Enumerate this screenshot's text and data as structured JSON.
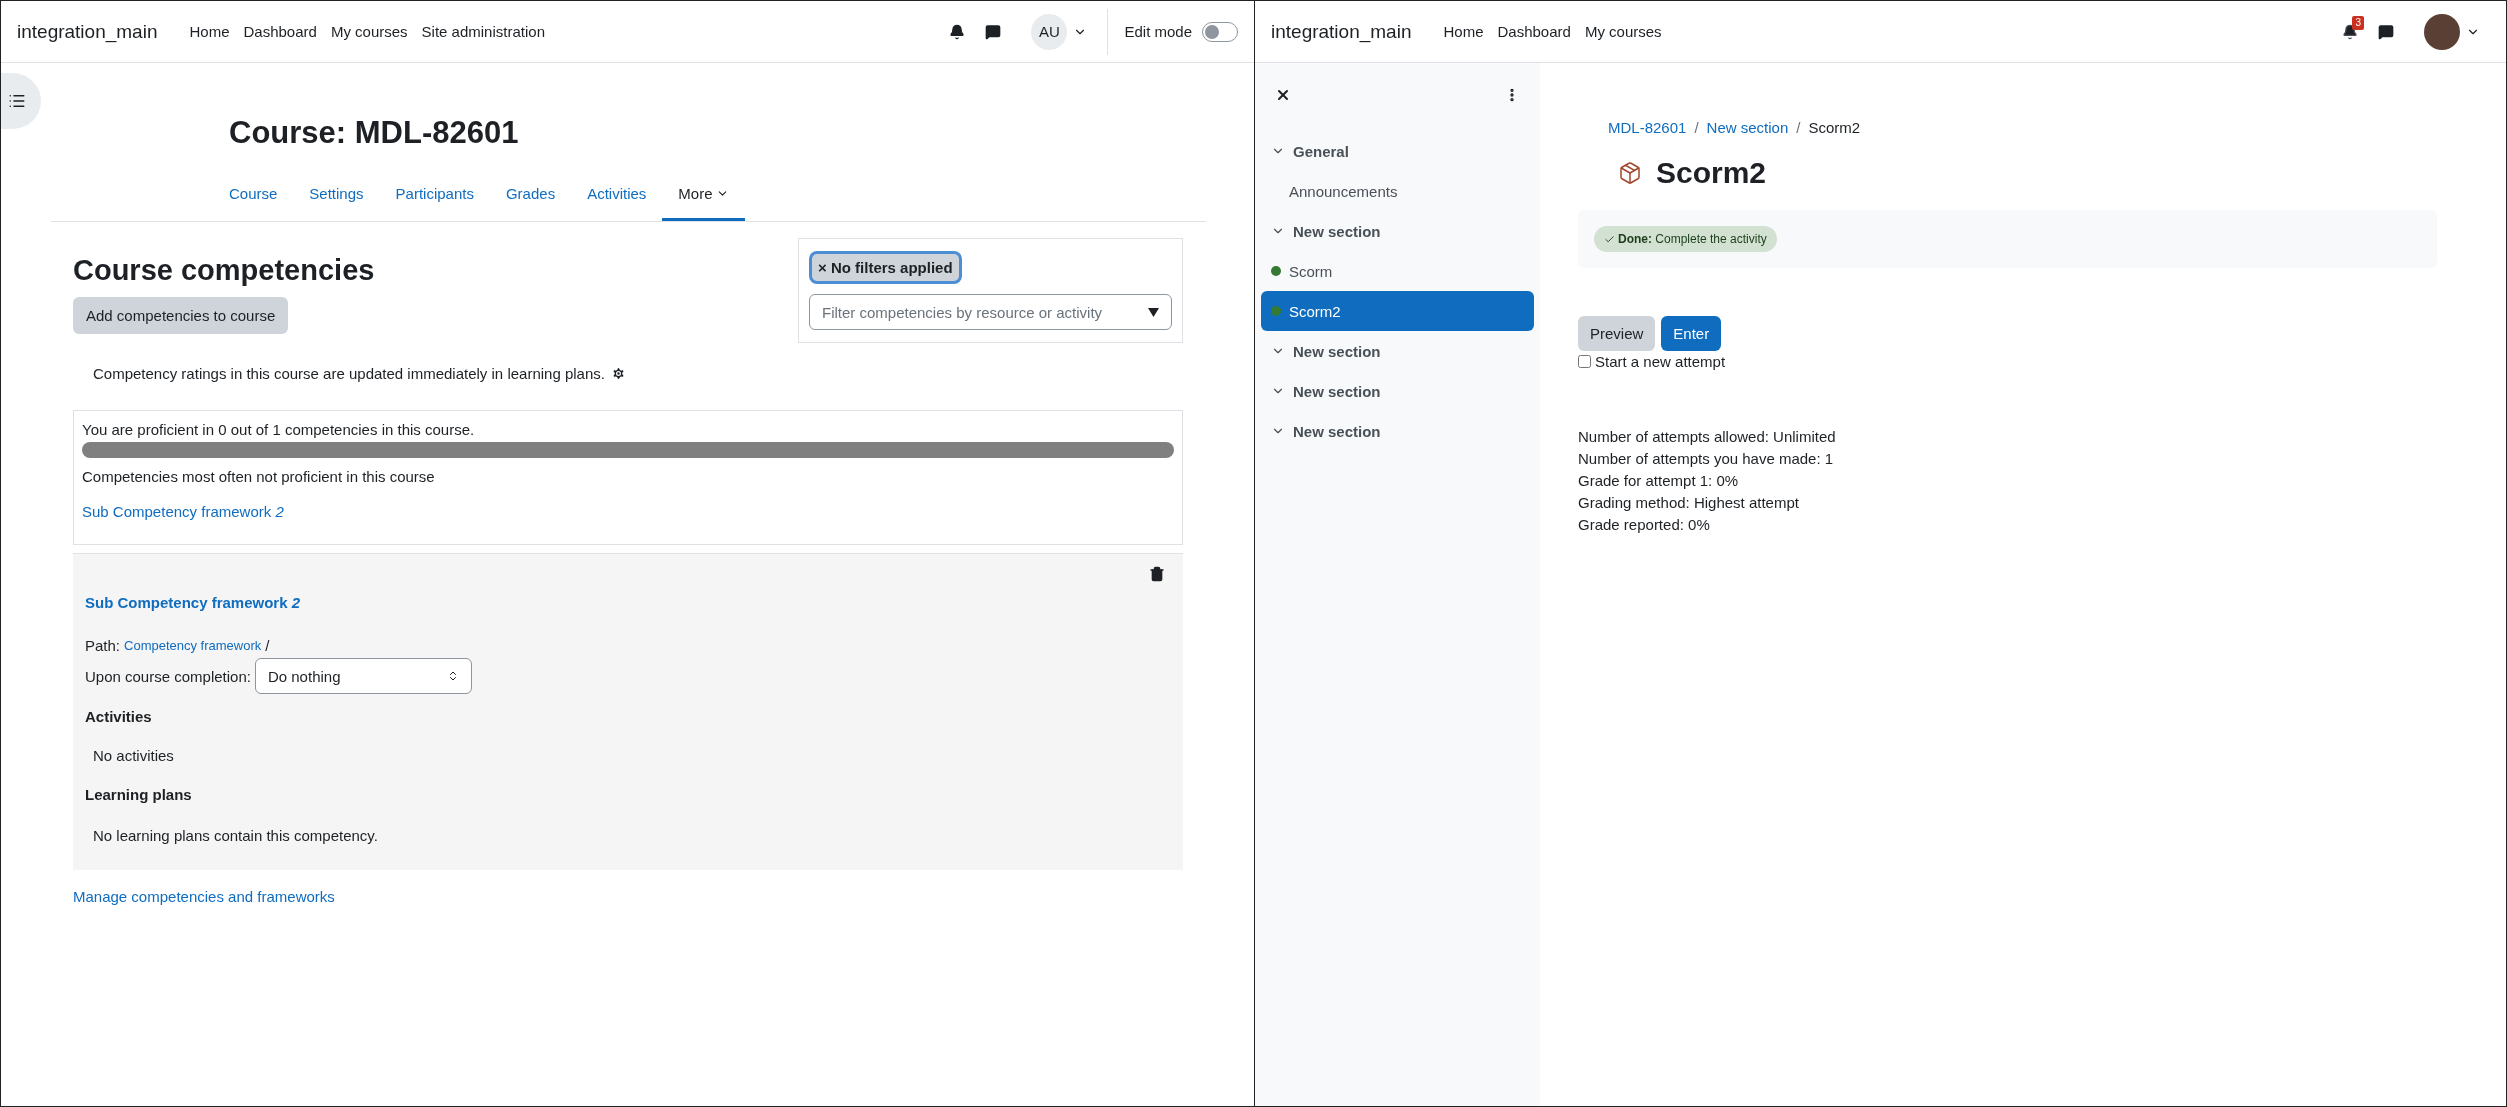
{
  "left_window": {
    "navbar": {
      "brand": "integration_main",
      "links": [
        "Home",
        "Dashboard",
        "My courses",
        "Site administration"
      ],
      "user_initials": "AU",
      "edit_mode": {
        "label": "Edit mode",
        "on": false
      }
    },
    "course_title": "Course: MDL-82601",
    "tabs": [
      {
        "label": "Course",
        "selected": false
      },
      {
        "label": "Settings",
        "selected": false
      },
      {
        "label": "Participants",
        "selected": false
      },
      {
        "label": "Grades",
        "selected": false
      },
      {
        "label": "Activities",
        "selected": false
      },
      {
        "label": "More",
        "selected": true
      }
    ],
    "heading": "Course competencies",
    "add_button": "Add competencies to course",
    "filter": {
      "chip": "× No filters applied",
      "placeholder": "Filter competencies by resource or activity"
    },
    "info": "Competency ratings in this course are updated immediately in learning plans.",
    "summary": {
      "proficient_text": "You are proficient in 0 out of 1 competencies in this course.",
      "level": 0,
      "subtitle": "Competencies most often not proficient in this course",
      "link": "Sub Competency framework *2*"
    },
    "competency": {
      "title": "Sub Competency framework *2*",
      "path_label": "Path:",
      "path_link": "Competency framework",
      "path_sep": "/",
      "completion_label": "Upon course completion:",
      "completion_value": "Do nothing",
      "activities_heading": "Activities",
      "activities_text": "No activities",
      "plans_heading": "Learning plans",
      "plans_text": "No learning plans contain this competency."
    },
    "manage_link": "Manage competencies and frameworks"
  },
  "right_window": {
    "navbar": {
      "brand": "integration_main",
      "links": [
        "Home",
        "Dashboard",
        "My courses"
      ],
      "notifications": "3"
    },
    "course_index": [
      {
        "kind": "section",
        "label": "General",
        "expanded": true,
        "selected": false
      },
      {
        "kind": "activity",
        "label": "Announcements",
        "done": false,
        "selected": false
      },
      {
        "kind": "section",
        "label": "New section",
        "expanded": true,
        "selected": false
      },
      {
        "kind": "activity",
        "label": "Scorm",
        "done": true,
        "selected": false
      },
      {
        "kind": "activity",
        "label": "Scorm2",
        "done": true,
        "selected": true
      },
      {
        "kind": "section",
        "label": "New section",
        "expanded": true,
        "selected": false
      },
      {
        "kind": "section",
        "label": "New section",
        "expanded": true,
        "selected": false
      },
      {
        "kind": "section",
        "label": "New section",
        "expanded": true,
        "selected": false
      }
    ],
    "breadcrumb": [
      "MDL-82601",
      "New section",
      "Scorm2"
    ],
    "breadcrumb_separator": "/",
    "title": "Scorm2",
    "completion": "**Done:** Complete the activity",
    "buttons": [
      {
        "label": "Preview",
        "kind": "secondary"
      },
      {
        "label": "Enter",
        "kind": "primary"
      }
    ],
    "new_attempt": {
      "label": "Start a new attempt",
      "checked": false
    },
    "details": [
      "Number of attempts allowed: Unlimited",
      "Number of attempts you have made: 1",
      "Grade for attempt 1: 0%",
      "Grading method: Highest attempt",
      "Grade reported: 0%"
    ]
  }
}
